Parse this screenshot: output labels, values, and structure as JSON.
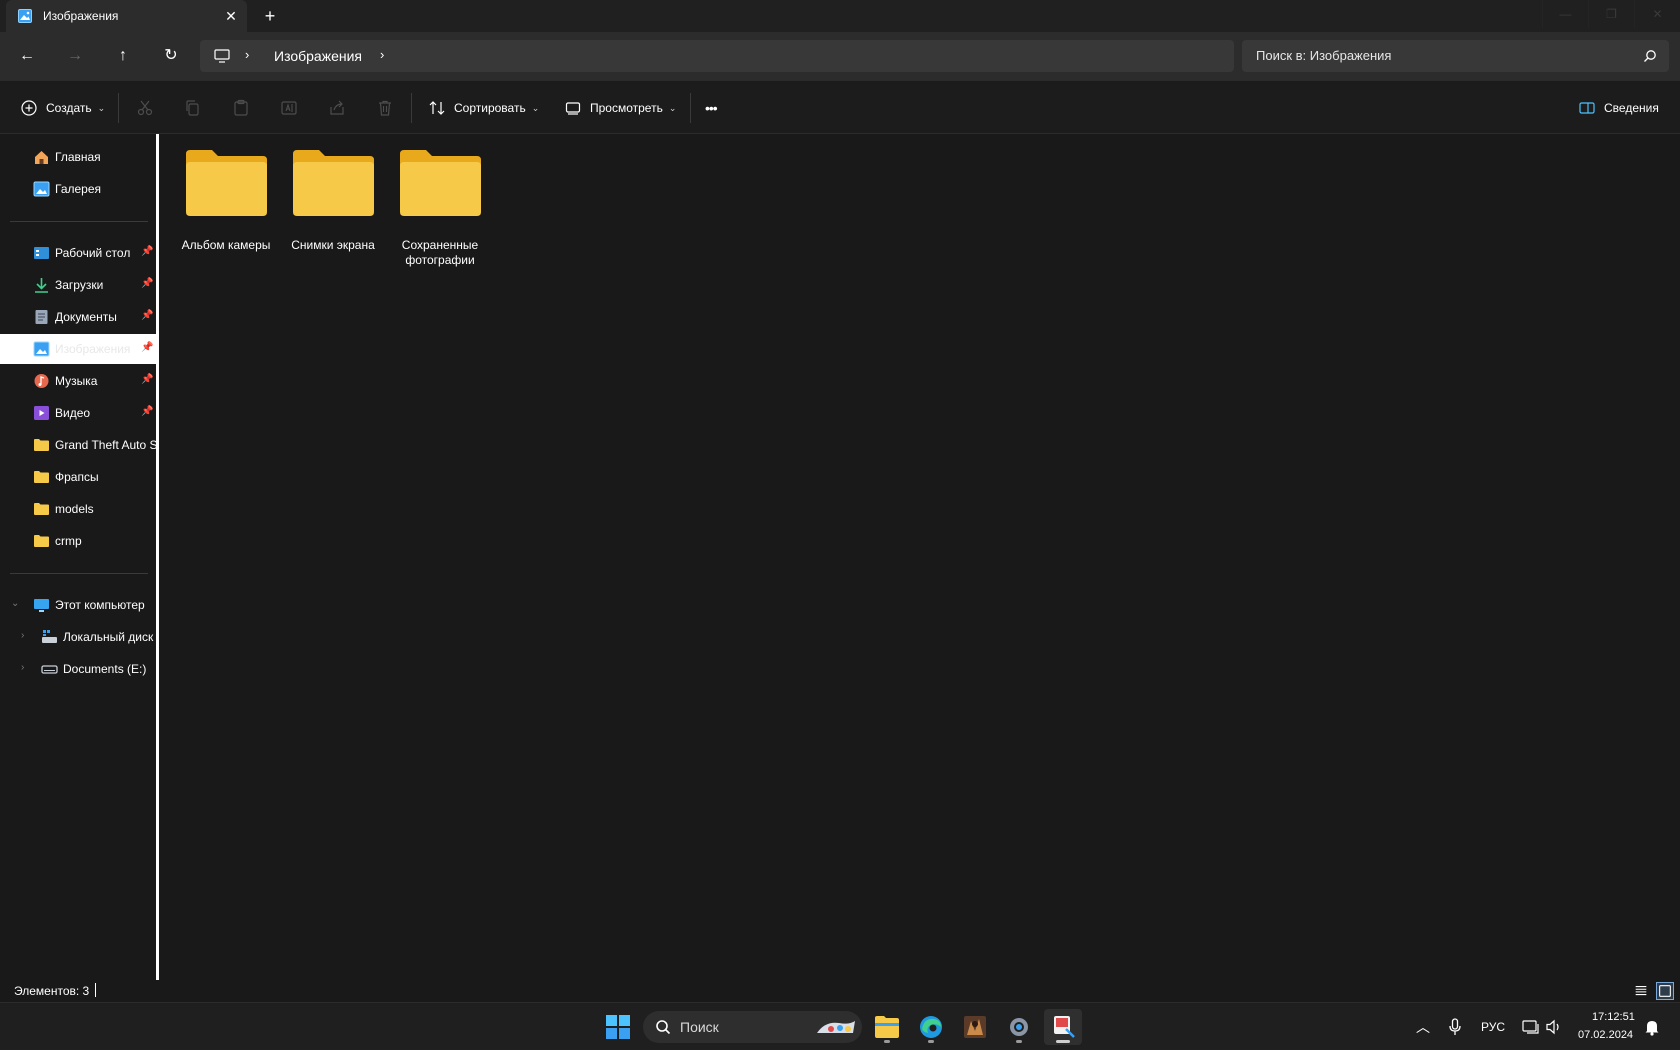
{
  "tab": {
    "title": "Изображения",
    "icon": "pictures-icon",
    "close": "✕",
    "new": "+"
  },
  "nav": {
    "back": "←",
    "forward": "→",
    "up": "↑",
    "refresh": "↻"
  },
  "address": {
    "location": "Изображения",
    "separator": "›"
  },
  "search": {
    "placeholder": "Поиск в: Изображения"
  },
  "commands": {
    "create": "Создать",
    "sort": "Сортировать",
    "view": "Просмотреть",
    "more": "•••",
    "details": "Сведения"
  },
  "sidebar": {
    "top": [
      {
        "label": "Главная",
        "icon": "home-icon"
      },
      {
        "label": "Галерея",
        "icon": "gallery-icon"
      }
    ],
    "pinned": [
      {
        "label": "Рабочий стол",
        "icon": "desktop-icon",
        "pinned": true
      },
      {
        "label": "Загрузки",
        "icon": "downloads-icon",
        "pinned": true
      },
      {
        "label": "Документы",
        "icon": "documents-icon",
        "pinned": true
      },
      {
        "label": "Изображения",
        "icon": "pictures-icon",
        "pinned": true,
        "selected": true
      },
      {
        "label": "Музыка",
        "icon": "music-icon",
        "pinned": true
      },
      {
        "label": "Видео",
        "icon": "videos-icon",
        "pinned": true
      },
      {
        "label": "Grand Theft Auto  S",
        "icon": "folder-icon"
      },
      {
        "label": "Фрапсы",
        "icon": "folder-icon"
      },
      {
        "label": "models",
        "icon": "folder-icon"
      },
      {
        "label": "crmp",
        "icon": "folder-icon"
      }
    ],
    "computer": {
      "label": "Этот компьютер",
      "icon": "this-pc-icon"
    },
    "drives": [
      {
        "label": "Локальный диск",
        "icon": "local-disk-icon"
      },
      {
        "label": "Documents (E:)",
        "icon": "drive-icon"
      }
    ]
  },
  "folders": [
    {
      "name": "Альбом камеры"
    },
    {
      "name": "Снимки экрана"
    },
    {
      "name": "Сохраненные фотографии"
    }
  ],
  "status": {
    "count": "Элементов: 3"
  },
  "taskbar": {
    "search": "Поиск",
    "language": "РУС",
    "time": "17:12:51",
    "date": "07.02.2024"
  },
  "colors": {
    "folder": "#f7c948",
    "folder_tab": "#e8a91c",
    "accent": "#4cc2ff",
    "selection": "#ffffff"
  }
}
